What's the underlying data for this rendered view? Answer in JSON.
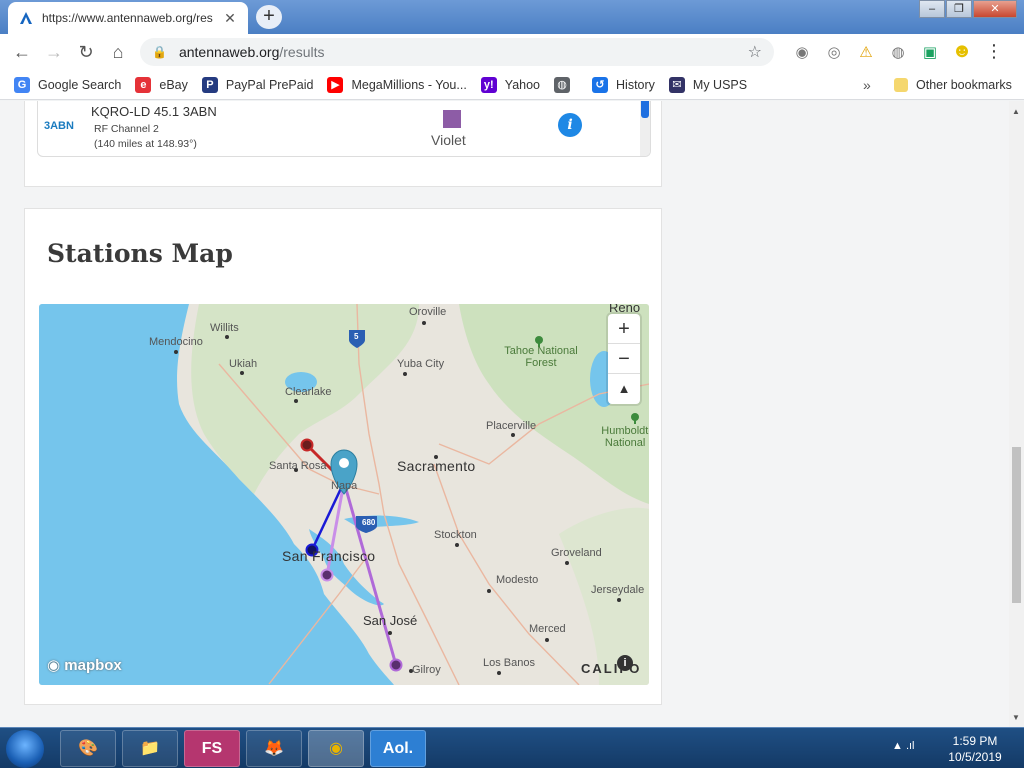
{
  "browser": {
    "tab_title": "https://www.antennaweb.org/res",
    "tab_close": "✕",
    "new_tab": "+",
    "window_min": "–",
    "window_max": "❐",
    "window_close": "✕",
    "url_host": "antennaweb.org",
    "url_path": "/results",
    "nav_back": "←",
    "nav_forward": "→",
    "nav_reload": "↻",
    "nav_home": "⌂",
    "star": "☆",
    "menu": "⋮"
  },
  "bookmarks": [
    {
      "label": "Google Search",
      "icon": "google-icon",
      "glyph": "G",
      "color": "#4285f4"
    },
    {
      "label": "eBay",
      "icon": "ebay-icon",
      "glyph": "e",
      "color": "#e53238"
    },
    {
      "label": "PayPal PrePaid",
      "icon": "paypal-icon",
      "glyph": "P",
      "color": "#253b80"
    },
    {
      "label": "MegaMillions - You...",
      "icon": "youtube-icon",
      "glyph": "▶",
      "color": "#ff0000"
    },
    {
      "label": "Yahoo",
      "icon": "yahoo-icon",
      "glyph": "y!",
      "color": "#6001d2"
    },
    {
      "label": "",
      "icon": "globe-icon",
      "glyph": "◍",
      "color": "#5f6368"
    },
    {
      "label": "History",
      "icon": "history-icon",
      "glyph": "↺",
      "color": "#1a73e8"
    },
    {
      "label": "My USPS",
      "icon": "usps-icon",
      "glyph": "✉",
      "color": "#333366"
    }
  ],
  "bookmarks_more": "»",
  "other_bookmarks": "Other bookmarks",
  "station": {
    "logo": "3ABN",
    "name": "KQRO-LD 45.1 3ABN",
    "channel": "RF Channel 2",
    "distance": "(140 miles at 148.93°)",
    "color_label": "Violet",
    "color_hex": "#8d5ca6",
    "info": "i"
  },
  "map_section": {
    "title": "Stations Map",
    "zoom_in": "+",
    "zoom_out": "−",
    "compass": "▲",
    "mapbox": "mapbox",
    "attribution": "i",
    "labels": [
      {
        "text": "Reno",
        "cls": "big"
      },
      {
        "text": "Oroville",
        "cls": ""
      },
      {
        "text": "Willits",
        "cls": ""
      },
      {
        "text": "Mendocino",
        "cls": ""
      },
      {
        "text": "Ukiah",
        "cls": ""
      },
      {
        "text": "Yuba City",
        "cls": ""
      },
      {
        "text": "Tahoe National Forest",
        "cls": ""
      },
      {
        "text": "Clearlake",
        "cls": ""
      },
      {
        "text": "Placerville",
        "cls": ""
      },
      {
        "text": "Humboldt-T National F",
        "cls": ""
      },
      {
        "text": "Santa Rosa",
        "cls": ""
      },
      {
        "text": "Sacramento",
        "cls": "huge"
      },
      {
        "text": "Napa",
        "cls": ""
      },
      {
        "text": "Stockton",
        "cls": ""
      },
      {
        "text": "San Francisco",
        "cls": "huge"
      },
      {
        "text": "Groveland",
        "cls": ""
      },
      {
        "text": "Modesto",
        "cls": ""
      },
      {
        "text": "Jerseydale",
        "cls": ""
      },
      {
        "text": "San José",
        "cls": "big"
      },
      {
        "text": "Merced",
        "cls": ""
      },
      {
        "text": "Los Banos",
        "cls": ""
      },
      {
        "text": "Gilroy",
        "cls": ""
      },
      {
        "text": "CALIFO",
        "cls": "big"
      },
      {
        "text": "5",
        "cls": ""
      },
      {
        "text": "680",
        "cls": ""
      }
    ],
    "line_colors": [
      "#c62828",
      "#1a1ad6",
      "#c98ee8",
      "#b06ad8"
    ]
  },
  "taskbar": {
    "items": [
      {
        "name": "paint-app",
        "label": "🎨"
      },
      {
        "name": "explorer-app",
        "label": "📁"
      },
      {
        "name": "fs-app",
        "label": "FS"
      },
      {
        "name": "firefox-app",
        "label": "🦊"
      },
      {
        "name": "chrome-app",
        "label": "◉"
      },
      {
        "name": "aol-app",
        "label": "Aol."
      }
    ],
    "time": "1:59 PM",
    "date": "10/5/2019",
    "tray": "▲ .ıl"
  }
}
